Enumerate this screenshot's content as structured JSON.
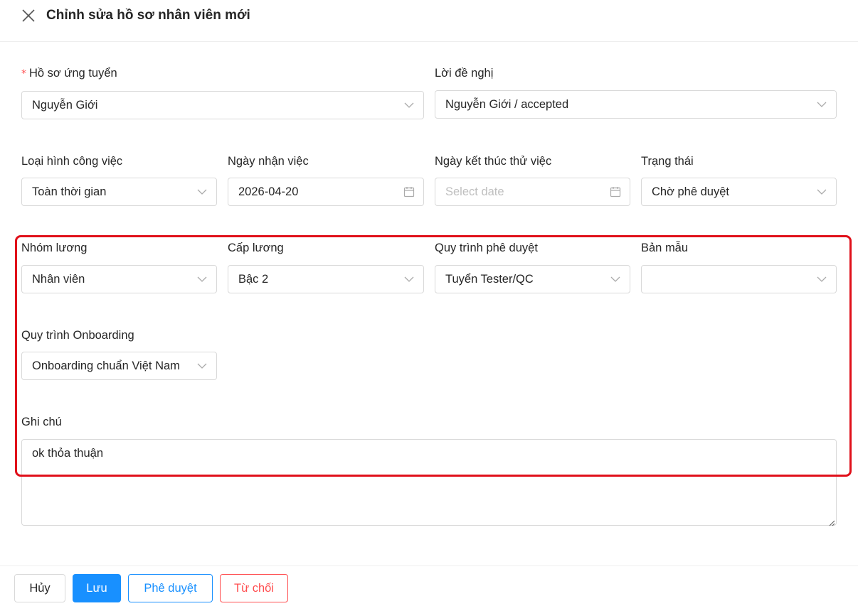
{
  "header": {
    "title": "Chỉnh sửa hồ sơ nhân viên mới"
  },
  "form": {
    "application": {
      "label": "Hồ sơ ứng tuyển",
      "required_mark": "*",
      "value": "Nguyễn Giới"
    },
    "offer": {
      "label": "Lời đề nghị",
      "value": "Nguyễn Giới / accepted"
    },
    "job_type": {
      "label": "Loại hình công việc",
      "value": "Toàn thời gian"
    },
    "start_date": {
      "label": "Ngày nhận việc",
      "value": "2026-04-20"
    },
    "probation_end": {
      "label": "Ngày kết thúc thử việc",
      "placeholder": "Select date"
    },
    "status": {
      "label": "Trạng thái",
      "value": "Chờ phê duyệt"
    },
    "salary_group": {
      "label": "Nhóm lương",
      "value": "Nhân viên"
    },
    "salary_level": {
      "label": "Cấp lương",
      "value": "Bậc 2"
    },
    "approval_process": {
      "label": "Quy trình phê duyệt",
      "value": "Tuyển Tester/QC"
    },
    "template": {
      "label": "Bản mẫu",
      "value": ""
    },
    "onboarding": {
      "label": "Quy trình Onboarding",
      "value": "Onboarding chuẩn Việt Nam"
    },
    "note": {
      "label": "Ghi chú",
      "value": "ok thỏa thuận"
    }
  },
  "footer": {
    "cancel_label": "Hủy",
    "save_label": "Lưu",
    "approve_label": "Phê duyệt",
    "reject_label": "Từ chối"
  },
  "colors": {
    "primary": "#1890ff",
    "danger": "#ff4d4f",
    "highlight": "#e0101a",
    "border": "#d9d9d9"
  },
  "icons": [
    "close-icon",
    "chevron-down-icon",
    "calendar-icon",
    "resize-handle-icon"
  ]
}
